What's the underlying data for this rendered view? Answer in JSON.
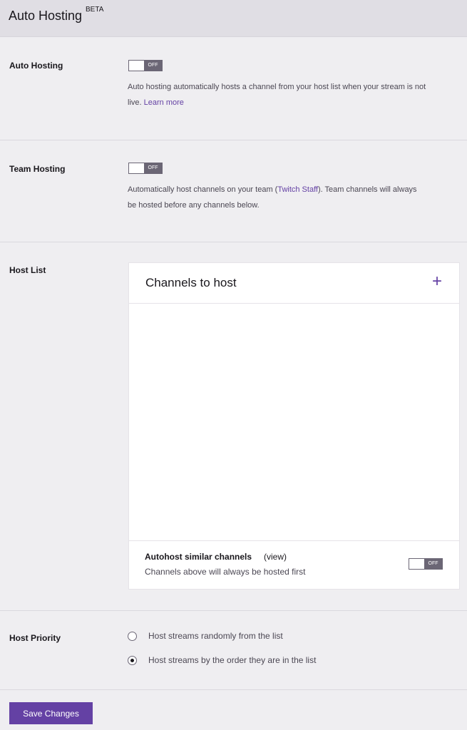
{
  "header": {
    "title": "Auto Hosting",
    "badge": "BETA"
  },
  "auto_hosting": {
    "label": "Auto Hosting",
    "toggle_state": "OFF",
    "description": "Auto hosting automatically hosts a channel from your host list when your stream is not",
    "description_2": "live.",
    "link": "Learn more"
  },
  "team_hosting": {
    "label": "Team Hosting",
    "toggle_state": "OFF",
    "description_pre": "Automatically host channels on your team (",
    "team_link": "Twitch Staff",
    "description_post": "). Team channels will always",
    "description_2": "be hosted before any channels below."
  },
  "host_list": {
    "label": "Host List",
    "panel_title": "Channels to host",
    "add_icon": "plus-icon",
    "add_glyph": "+",
    "similar_title": "Autohost similar channels",
    "similar_view": "(view)",
    "similar_desc": "Channels above will always be hosted first",
    "toggle_state": "OFF"
  },
  "host_priority": {
    "label": "Host Priority",
    "options": [
      {
        "label": "Host streams randomly from the list",
        "checked": false
      },
      {
        "label": "Host streams by the order they are in the list",
        "checked": true
      }
    ]
  },
  "save": {
    "label": "Save Changes"
  },
  "colors": {
    "accent": "#6441a4",
    "background": "#efeef1",
    "header": "#e0dee4"
  }
}
